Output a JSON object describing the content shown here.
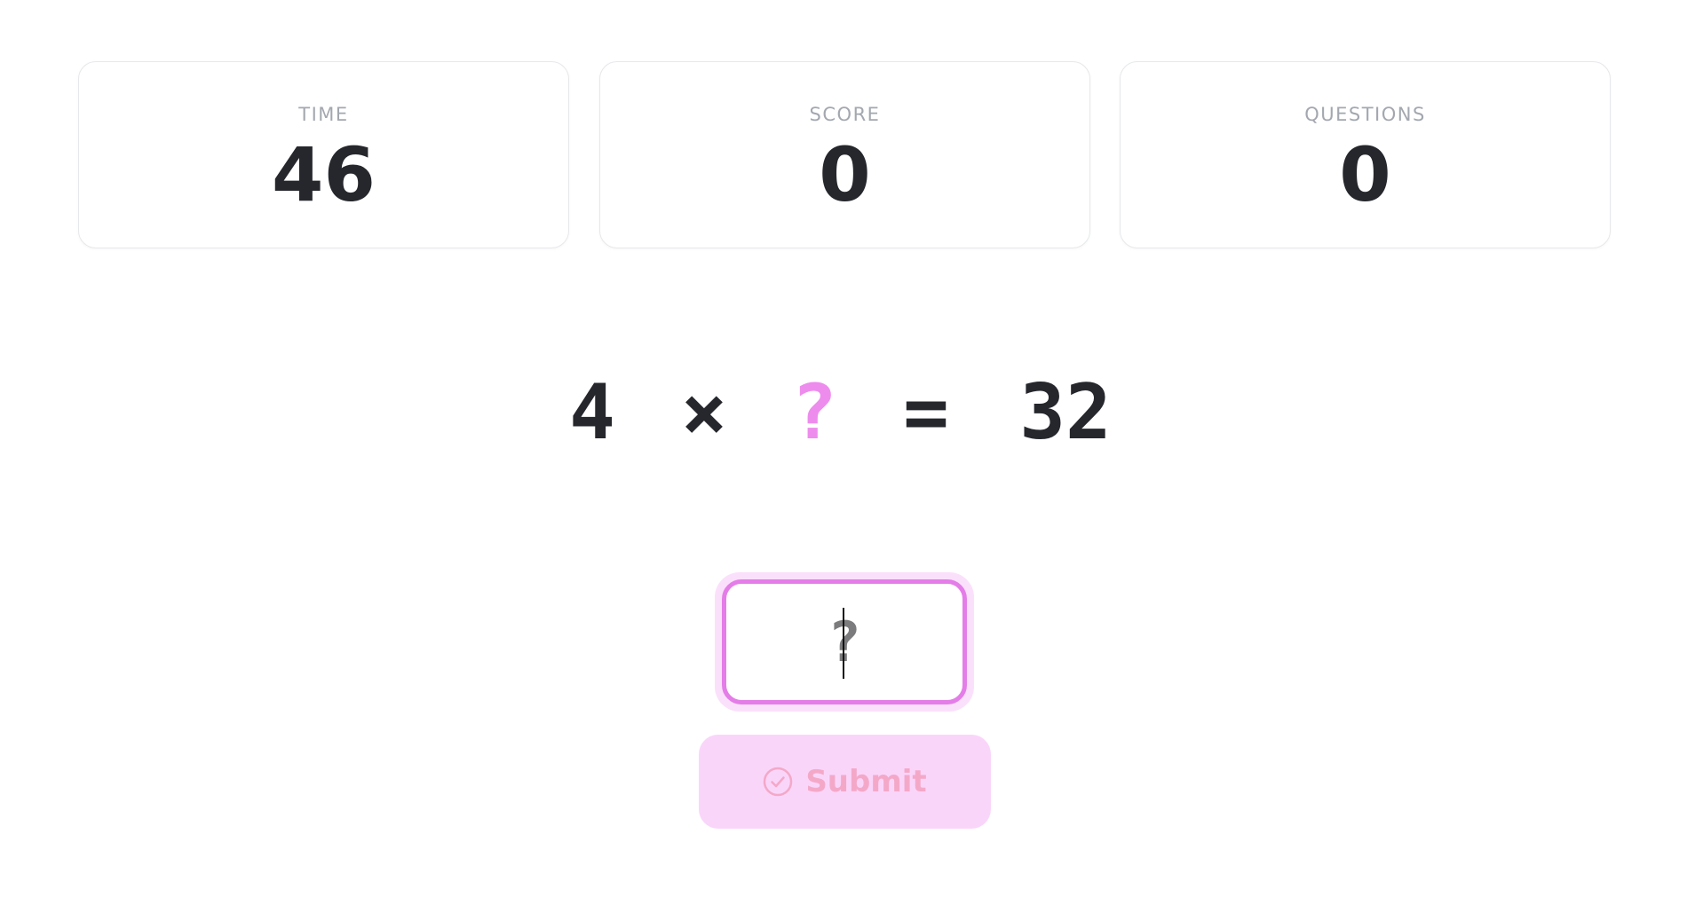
{
  "stats": {
    "time": {
      "label": "TIME",
      "value": "46"
    },
    "score": {
      "label": "SCORE",
      "value": "0"
    },
    "questions": {
      "label": "QUESTIONS",
      "value": "0"
    }
  },
  "equation": {
    "operand_a": "4",
    "operator": "×",
    "unknown": "?",
    "equals": "=",
    "result": "32"
  },
  "answer": {
    "placeholder": "?",
    "value": ""
  },
  "submit": {
    "label": "Submit",
    "icon": "check-circle-icon"
  },
  "colors": {
    "accent": "#e47de8",
    "unknown": "#ee8cee",
    "submit_bg": "#fad5fa",
    "submit_text": "#f4a8c8"
  }
}
